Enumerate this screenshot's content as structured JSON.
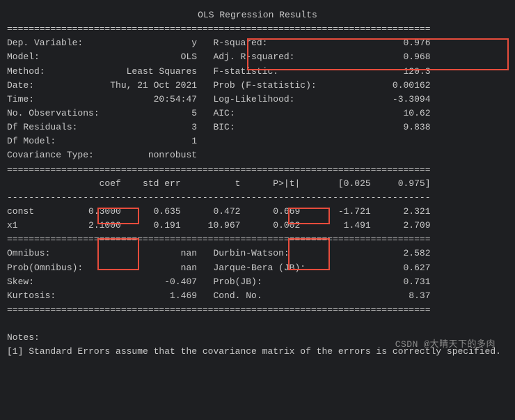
{
  "title": "OLS Regression Results",
  "rule_double": "==============================================================================",
  "rule_single": "------------------------------------------------------------------------------",
  "top": {
    "rows": [
      {
        "l_label": "Dep. Variable:",
        "l_val": "y",
        "r_label": "R-squared:",
        "r_val": "0.976"
      },
      {
        "l_label": "Model:",
        "l_val": "OLS",
        "r_label": "Adj. R-squared:",
        "r_val": "0.968"
      },
      {
        "l_label": "Method:",
        "l_val": "Least Squares",
        "r_label": "F-statistic:",
        "r_val": "120.3"
      },
      {
        "l_label": "Date:",
        "l_val": "Thu, 21 Oct 2021",
        "r_label": "Prob (F-statistic):",
        "r_val": "0.00162"
      },
      {
        "l_label": "Time:",
        "l_val": "20:54:47",
        "r_label": "Log-Likelihood:",
        "r_val": "-3.3094"
      },
      {
        "l_label": "No. Observations:",
        "l_val": "5",
        "r_label": "AIC:",
        "r_val": "10.62"
      },
      {
        "l_label": "Df Residuals:",
        "l_val": "3",
        "r_label": "BIC:",
        "r_val": "9.838"
      },
      {
        "l_label": "Df Model:",
        "l_val": "1",
        "r_label": "",
        "r_val": ""
      },
      {
        "l_label": "Covariance Type:",
        "l_val": "nonrobust",
        "r_label": "",
        "r_val": ""
      }
    ]
  },
  "coef_header": {
    "c0": "",
    "c1": "coef",
    "c2": "std err",
    "c3": "t",
    "c4": "P>|t|",
    "c5": "[0.025",
    "c6": "0.975]"
  },
  "coef_rows": [
    {
      "name": "const",
      "coef": "0.3000",
      "stderr": "0.635",
      "t": "0.472",
      "p": "0.669",
      "lo": "-1.721",
      "hi": "2.321"
    },
    {
      "name": "x1",
      "coef": "2.1000",
      "stderr": "0.191",
      "t": "10.967",
      "p": "0.002",
      "lo": "1.491",
      "hi": "2.709"
    }
  ],
  "diag": {
    "rows": [
      {
        "l_label": "Omnibus:",
        "l_val": "nan",
        "r_label": "Durbin-Watson:",
        "r_val": "2.582"
      },
      {
        "l_label": "Prob(Omnibus):",
        "l_val": "nan",
        "r_label": "Jarque-Bera (JB):",
        "r_val": "0.627"
      },
      {
        "l_label": "Skew:",
        "l_val": "-0.407",
        "r_label": "Prob(JB):",
        "r_val": "0.731"
      },
      {
        "l_label": "Kurtosis:",
        "l_val": "1.469",
        "r_label": "Cond. No.",
        "r_val": "8.37"
      }
    ]
  },
  "notes_label": "Notes:",
  "notes_line": "[1] Standard Errors assume that the covariance matrix of the errors is correctly specified.",
  "watermark": "CSDN @大晴天下的多肉"
}
